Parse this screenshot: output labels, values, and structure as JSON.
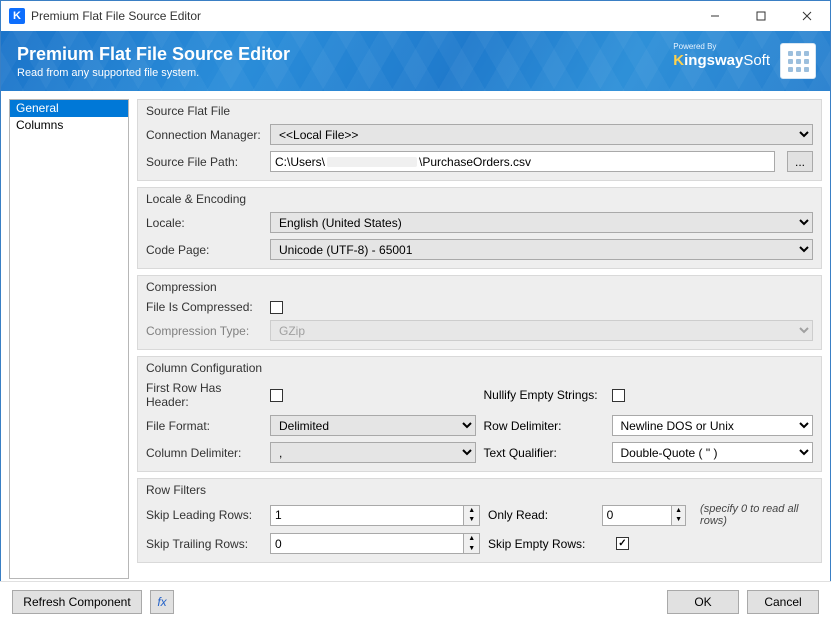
{
  "window": {
    "title": "Premium Flat File Source Editor"
  },
  "banner": {
    "title": "Premium Flat File Source Editor",
    "subtitle": "Read from any supported file system.",
    "powered_by": "Powered By",
    "brand_k": "K",
    "brand_ingsway": "ingsway",
    "brand_soft": "Soft"
  },
  "sidebar": {
    "items": [
      {
        "label": "General",
        "selected": true
      },
      {
        "label": "Columns",
        "selected": false
      }
    ]
  },
  "sections": {
    "source": {
      "title": "Source Flat File",
      "conn_label": "Connection Manager:",
      "conn_value": "<<Local File>>",
      "path_label": "Source File Path:",
      "path_prefix": "C:\\Users\\",
      "path_suffix": "\\PurchaseOrders.csv",
      "browse_label": "..."
    },
    "locale": {
      "title": "Locale & Encoding",
      "locale_label": "Locale:",
      "locale_value": "English (United States)",
      "codepage_label": "Code Page:",
      "codepage_value": "Unicode (UTF-8) - 65001"
    },
    "compression": {
      "title": "Compression",
      "is_compressed_label": "File Is Compressed:",
      "is_compressed": false,
      "type_label": "Compression Type:",
      "type_value": "GZip"
    },
    "columns": {
      "title": "Column Configuration",
      "first_row_label": "First Row Has Header:",
      "first_row": false,
      "nullify_label": "Nullify Empty Strings:",
      "nullify": false,
      "file_format_label": "File Format:",
      "file_format_value": "Delimited",
      "row_delim_label": "Row Delimiter:",
      "row_delim_value": "Newline DOS or Unix",
      "col_delim_label": "Column Delimiter:",
      "col_delim_value": ",",
      "text_qual_label": "Text Qualifier:",
      "text_qual_value": "Double-Quote ( \" )"
    },
    "filters": {
      "title": "Row Filters",
      "skip_lead_label": "Skip Leading Rows:",
      "skip_lead_value": "1",
      "only_read_label": "Only Read:",
      "only_read_value": "0",
      "only_read_hint": "(specify 0 to read all rows)",
      "skip_trail_label": "Skip Trailing Rows:",
      "skip_trail_value": "0",
      "skip_empty_label": "Skip Empty Rows:",
      "skip_empty": true
    }
  },
  "bottom": {
    "refresh": "Refresh Component",
    "fx": "fx",
    "ok": "OK",
    "cancel": "Cancel"
  }
}
